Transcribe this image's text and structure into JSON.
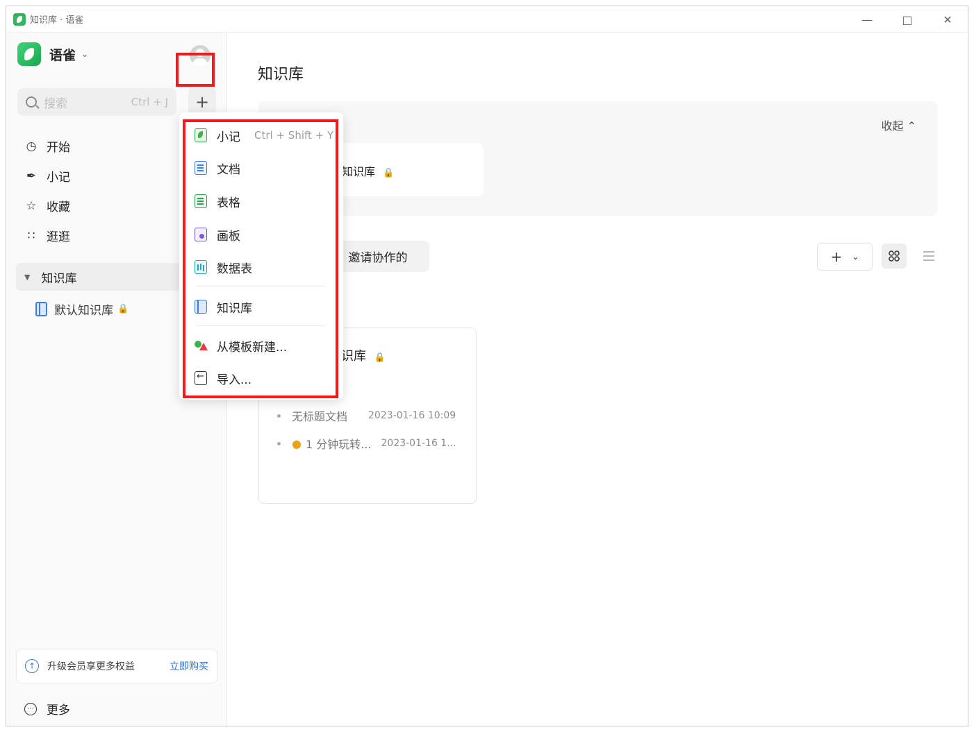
{
  "window": {
    "title": "知识库 · 语雀"
  },
  "sidebar": {
    "brand": "语雀",
    "search": {
      "placeholder": "搜索",
      "shortcut": "Ctrl + J"
    },
    "nav": [
      {
        "label": "开始",
        "icon": "clock-icon"
      },
      {
        "label": "小记",
        "icon": "feather-icon"
      },
      {
        "label": "收藏",
        "icon": "star-icon"
      },
      {
        "label": "逛逛",
        "icon": "grid-icon"
      }
    ],
    "knowledge_section": "知识库",
    "knowledge_items": [
      {
        "label": "默认知识库",
        "locked": true
      }
    ],
    "upgrade": {
      "text": "升级会员享更多权益",
      "link": "立即购买"
    },
    "more": "更多"
  },
  "main": {
    "title": "知识库",
    "collapse": "收起",
    "recent_card_label": "知识库",
    "tab_invited": "邀请协作的",
    "card": {
      "title": "识库",
      "docs": [
        {
          "name": "无标题文档",
          "date": "2023-01-16 10:09"
        },
        {
          "name": "1 分钟玩转...",
          "date": "2023-01-16 1..."
        }
      ]
    }
  },
  "menu": {
    "items": [
      {
        "label": "小记",
        "shortcut": "Ctrl + Shift + Y",
        "icon": "note-icon"
      },
      {
        "label": "文档",
        "icon": "doc-icon"
      },
      {
        "label": "表格",
        "icon": "sheet-icon"
      },
      {
        "label": "画板",
        "icon": "board-icon"
      },
      {
        "label": "数据表",
        "icon": "datatable-icon"
      },
      {
        "label": "知识库",
        "icon": "book-icon"
      },
      {
        "label": "从模板新建...",
        "icon": "template-icon"
      },
      {
        "label": "导入...",
        "icon": "import-icon"
      }
    ]
  },
  "colors": {
    "highlight": "#f5181c",
    "brand_green": "#31b85c",
    "link_blue": "#2f6fe0"
  }
}
